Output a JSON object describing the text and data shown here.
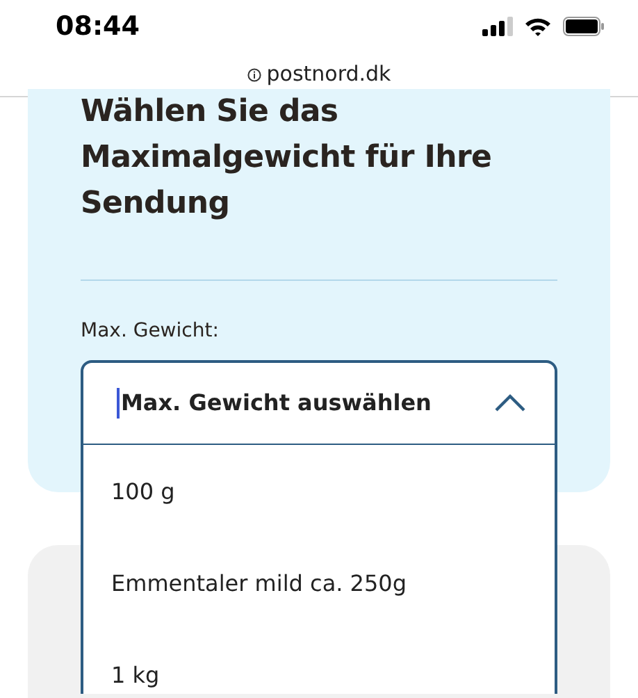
{
  "status_bar": {
    "time": "08:44"
  },
  "address_bar": {
    "url": "postnord.dk"
  },
  "weight_card": {
    "heading": "Wählen Sie das Maximalgewicht für Ihre Sendung",
    "field_label": "Max. Gewicht:",
    "select": {
      "placeholder": "Max. Gewicht auswählen",
      "expanded": true,
      "focused": true,
      "options": [
        {
          "label": "100 g",
          "selected": false
        },
        {
          "label": "Emmentaler mild ca. 250g",
          "selected": false
        },
        {
          "label": "1 kg",
          "selected": false
        }
      ]
    }
  }
}
